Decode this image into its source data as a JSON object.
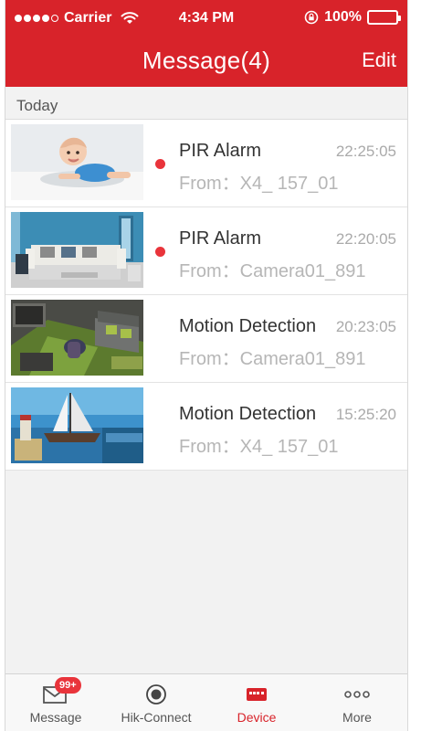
{
  "status_bar": {
    "carrier": "Carrier",
    "time": "4:34 PM",
    "battery": "100%"
  },
  "nav": {
    "title": "Message(4)",
    "edit_label": "Edit"
  },
  "section": {
    "header": "Today"
  },
  "messages": [
    {
      "title": "PIR Alarm",
      "time": "22:25:05",
      "from": "From：X4_ 157_01",
      "unread": true,
      "thumb": "baby-icon"
    },
    {
      "title": "PIR Alarm",
      "time": "22:20:05",
      "from": "From：Camera01_891",
      "unread": true,
      "thumb": "living-room-icon"
    },
    {
      "title": "Motion Detection",
      "time": "20:23:05",
      "from": "From：Camera01_891",
      "unread": false,
      "thumb": "room-overhead-icon"
    },
    {
      "title": "Motion Detection",
      "time": "15:25:20",
      "from": "From：X4_ 157_01",
      "unread": false,
      "thumb": "sailboat-icon"
    }
  ],
  "tabbar": {
    "badge": "99+",
    "tabs": [
      {
        "label": "Message",
        "icon": "envelope-icon"
      },
      {
        "label": "Hik-Connect",
        "icon": "record-icon"
      },
      {
        "label": "Device",
        "icon": "device-icon"
      },
      {
        "label": "More",
        "icon": "more-dots-icon"
      }
    ]
  },
  "colors": {
    "brand": "#d8232a",
    "unread_dot": "#e9343b"
  }
}
